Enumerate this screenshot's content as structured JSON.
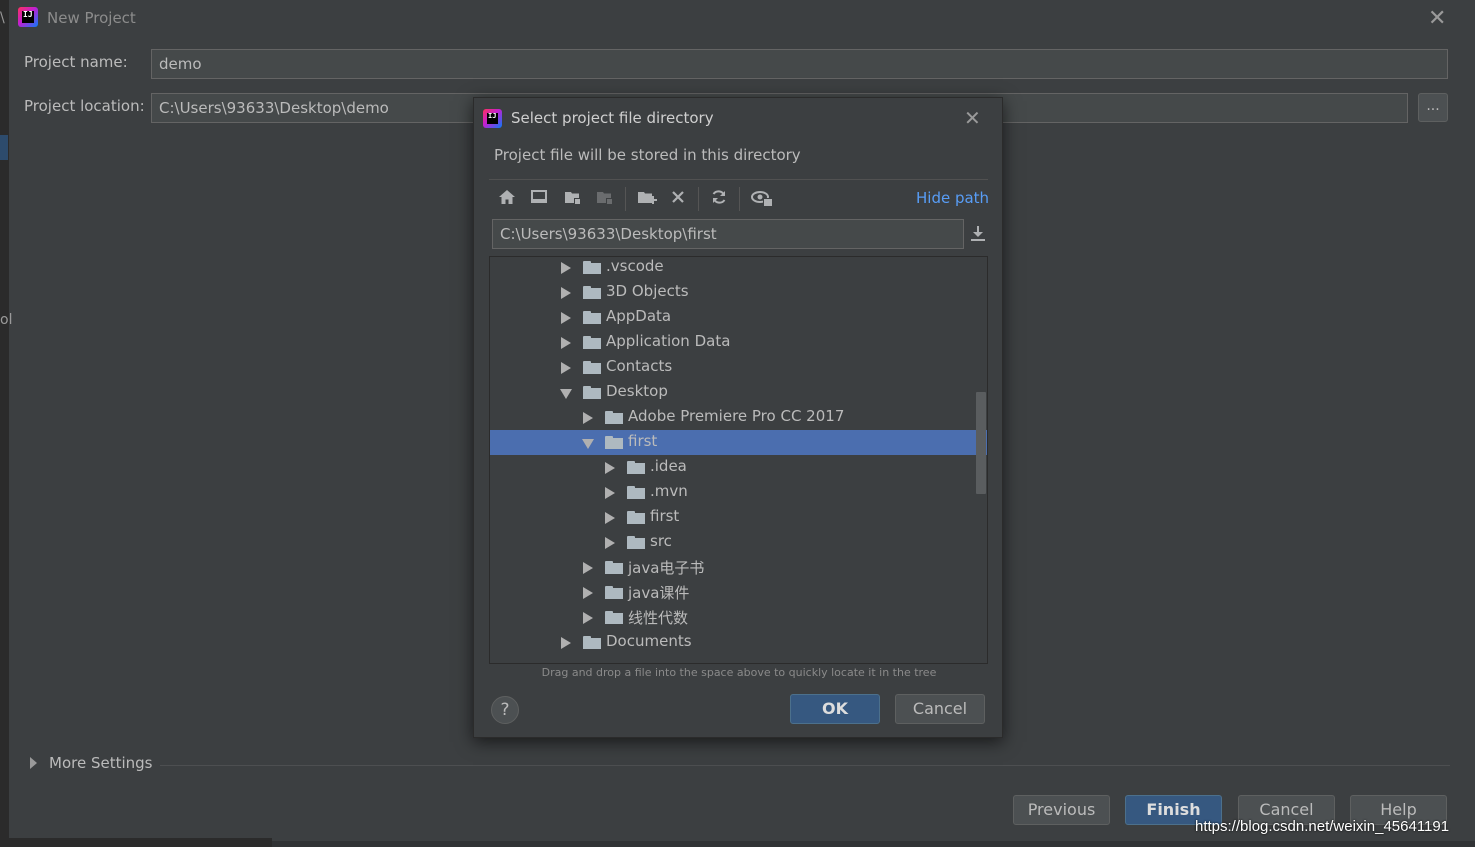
{
  "window": {
    "title": "New Project",
    "close_glyph": "✕",
    "left_edge_text": "ol",
    "left_edge_top_text": "\\"
  },
  "form": {
    "project_name_label": "Project name:",
    "project_name_value": "demo",
    "project_location_label": "Project location:",
    "project_location_value": "C:\\Users\\93633\\Desktop\\demo",
    "browse_label": "..."
  },
  "more_settings": {
    "label": "More Settings"
  },
  "footer": {
    "previous_label": "Previous",
    "finish_label": "Finish",
    "cancel_label": "Cancel",
    "help_label": "Help",
    "watermark": "https://blog.csdn.net/weixin_45641191"
  },
  "dialog": {
    "title": "Select project file directory",
    "close_glyph": "✕",
    "description": "Project file will be stored in this directory",
    "hide_path_label": "Hide path",
    "path_value": "C:\\Users\\93633\\Desktop\\first",
    "hint": "Drag and drop a file into the space above to quickly locate it in the tree",
    "help_glyph": "?",
    "ok_label": "OK",
    "cancel_label": "Cancel",
    "toolbar_icons": [
      "home-icon",
      "desktop-icon",
      "project-folder-icon",
      "module-folder-icon",
      "new-folder-icon",
      "delete-icon",
      "refresh-icon",
      "show-hidden-icon"
    ]
  },
  "tree": [
    {
      "name": ".vscode",
      "depth": 0,
      "expanded": false,
      "selected": false
    },
    {
      "name": "3D Objects",
      "depth": 0,
      "expanded": false,
      "selected": false
    },
    {
      "name": "AppData",
      "depth": 0,
      "expanded": false,
      "selected": false
    },
    {
      "name": "Application Data",
      "depth": 0,
      "expanded": false,
      "selected": false
    },
    {
      "name": "Contacts",
      "depth": 0,
      "expanded": false,
      "selected": false
    },
    {
      "name": "Desktop",
      "depth": 0,
      "expanded": true,
      "selected": false
    },
    {
      "name": "Adobe Premiere Pro CC 2017",
      "depth": 1,
      "expanded": false,
      "selected": false
    },
    {
      "name": "first",
      "depth": 1,
      "expanded": true,
      "selected": true
    },
    {
      "name": ".idea",
      "depth": 2,
      "expanded": false,
      "selected": false
    },
    {
      "name": ".mvn",
      "depth": 2,
      "expanded": false,
      "selected": false
    },
    {
      "name": "first",
      "depth": 2,
      "expanded": false,
      "selected": false
    },
    {
      "name": "src",
      "depth": 2,
      "expanded": false,
      "selected": false
    },
    {
      "name": "java电子书",
      "depth": 1,
      "expanded": false,
      "selected": false
    },
    {
      "name": "java课件",
      "depth": 1,
      "expanded": false,
      "selected": false
    },
    {
      "name": "线性代数",
      "depth": 1,
      "expanded": false,
      "selected": false
    },
    {
      "name": "Documents",
      "depth": 0,
      "expanded": false,
      "selected": false
    }
  ]
}
